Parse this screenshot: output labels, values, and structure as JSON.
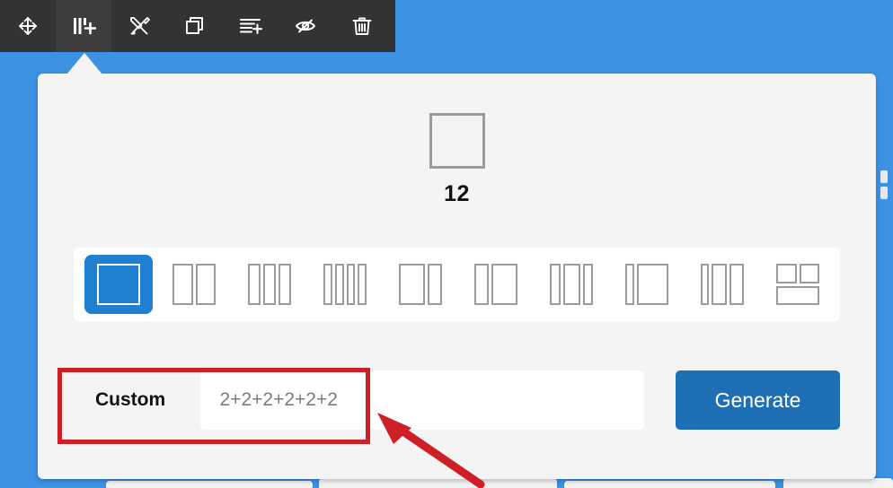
{
  "window": {
    "background_color": "#3d92e3",
    "toolbar_background": "#333333",
    "panel_background": "#f4f4f4",
    "accent_color": "#1f7fd0",
    "button_color": "#1f6fb5",
    "annotation_color": "#cc2026"
  },
  "toolbar": {
    "items": [
      {
        "name": "move-tool",
        "icon": "move-arrows-icon",
        "active": false
      },
      {
        "name": "columns-tool",
        "icon": "columns-plus-icon",
        "active": true
      },
      {
        "name": "settings-tool",
        "icon": "tools-icon",
        "active": false
      },
      {
        "name": "duplicate-tool",
        "icon": "copy-icon",
        "active": false
      },
      {
        "name": "add-row-tool",
        "icon": "list-plus-icon",
        "active": false
      },
      {
        "name": "hide-tool",
        "icon": "eye-slash-icon",
        "active": false
      },
      {
        "name": "delete-tool",
        "icon": "trash-icon",
        "active": false
      }
    ]
  },
  "panel": {
    "preview": {
      "count": "12",
      "shape": "single-column-box"
    },
    "layouts": [
      {
        "label": "1 column (12)",
        "pattern": [
          12
        ],
        "selected": true
      },
      {
        "label": "2 columns (6+6)",
        "pattern": [
          6,
          6
        ],
        "selected": false
      },
      {
        "label": "3 columns (4+4+4)",
        "pattern": [
          4,
          4,
          4
        ],
        "selected": false
      },
      {
        "label": "4 columns (3+3+3+3)",
        "pattern": [
          3,
          3,
          3,
          3
        ],
        "selected": false
      },
      {
        "label": "2 columns (8+4)",
        "pattern": [
          8,
          4
        ],
        "selected": false
      },
      {
        "label": "2 columns (4+8)",
        "pattern": [
          4,
          8
        ],
        "selected": false
      },
      {
        "label": "3 columns (3+6+3)",
        "pattern": [
          3,
          6,
          3
        ],
        "selected": false
      },
      {
        "label": "2 columns (2+10)",
        "pattern": [
          2,
          10
        ],
        "selected": false
      },
      {
        "label": "3 columns (2+5+5)",
        "pattern": [
          2,
          5,
          5
        ],
        "selected": false
      },
      {
        "label": "grid (6+6 / 12)",
        "pattern": "grid",
        "selected": false
      }
    ],
    "custom": {
      "label": "Custom",
      "value": "",
      "placeholder": "2+2+2+2+2+2"
    },
    "generate_label": "Generate"
  },
  "annotation": {
    "highlight_target": "custom-input-row",
    "arrow_direction": "up-left"
  }
}
